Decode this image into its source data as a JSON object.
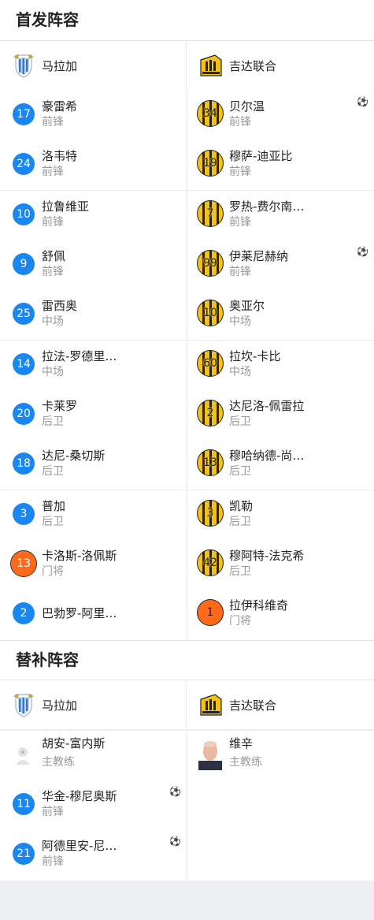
{
  "starting": {
    "title": "首发阵容",
    "home_team": "马拉加",
    "away_team": "吉达联合",
    "home": [
      {
        "num": "17",
        "name": "豪雷希",
        "pos": "前锋"
      },
      {
        "num": "24",
        "name": "洛韦特",
        "pos": "前锋"
      },
      {
        "num": "10",
        "name": "拉鲁维亚",
        "pos": "前锋"
      },
      {
        "num": "9",
        "name": "舒佩",
        "pos": "前锋"
      },
      {
        "num": "25",
        "name": "雷西奥",
        "pos": "中场"
      },
      {
        "num": "14",
        "name": "拉法-罗德里…",
        "pos": "中场"
      },
      {
        "num": "20",
        "name": "卡莱罗",
        "pos": "后卫"
      },
      {
        "num": "18",
        "name": "达尼-桑切斯",
        "pos": "后卫"
      },
      {
        "num": "3",
        "name": "普加",
        "pos": "后卫"
      },
      {
        "num": "13",
        "name": "卡洛斯-洛佩斯",
        "pos": "门将"
      },
      {
        "num": "2",
        "name": "巴勃罗-阿里…",
        "pos": ""
      }
    ],
    "away": [
      {
        "num": "34",
        "name": "贝尔温",
        "pos": "前锋",
        "goal": "⚽"
      },
      {
        "num": "19",
        "name": "穆萨-迪亚比",
        "pos": "前锋"
      },
      {
        "num": "7",
        "name": "罗热-费尔南…",
        "pos": "前锋"
      },
      {
        "num": "99",
        "name": "伊莱尼赫纳",
        "pos": "前锋",
        "goal": "⚽"
      },
      {
        "num": "10",
        "name": "奥亚尔",
        "pos": "中场"
      },
      {
        "num": "60",
        "name": "拉坎-卡比",
        "pos": "中场"
      },
      {
        "num": "2",
        "name": "达尼洛-佩雷拉",
        "pos": "后卫"
      },
      {
        "num": "13",
        "name": "穆哈纳德-尚…",
        "pos": "后卫"
      },
      {
        "num": "3",
        "name": "凯勒",
        "pos": "后卫"
      },
      {
        "num": "42",
        "name": "穆阿特-法克希",
        "pos": "后卫"
      },
      {
        "num": "1",
        "name": "拉伊科维奇",
        "pos": "门将"
      }
    ]
  },
  "subs": {
    "title": "替补阵容",
    "home_team": "马拉加",
    "away_team": "吉达联合",
    "home_coach": {
      "name": "胡安-富内斯",
      "pos": "主教练"
    },
    "away_coach": {
      "name": "维辛",
      "pos": "主教练"
    },
    "home": [
      {
        "num": "11",
        "name": "华金-穆尼奥斯",
        "pos": "前锋",
        "goal": "⚽"
      },
      {
        "num": "21",
        "name": "阿德里安-尼…",
        "pos": "前锋",
        "goal": "⚽"
      }
    ]
  },
  "colors": {
    "home_badge": "#1a86f0",
    "keeper": "#ff6a1a",
    "away_yellow": "#f3c21a"
  }
}
